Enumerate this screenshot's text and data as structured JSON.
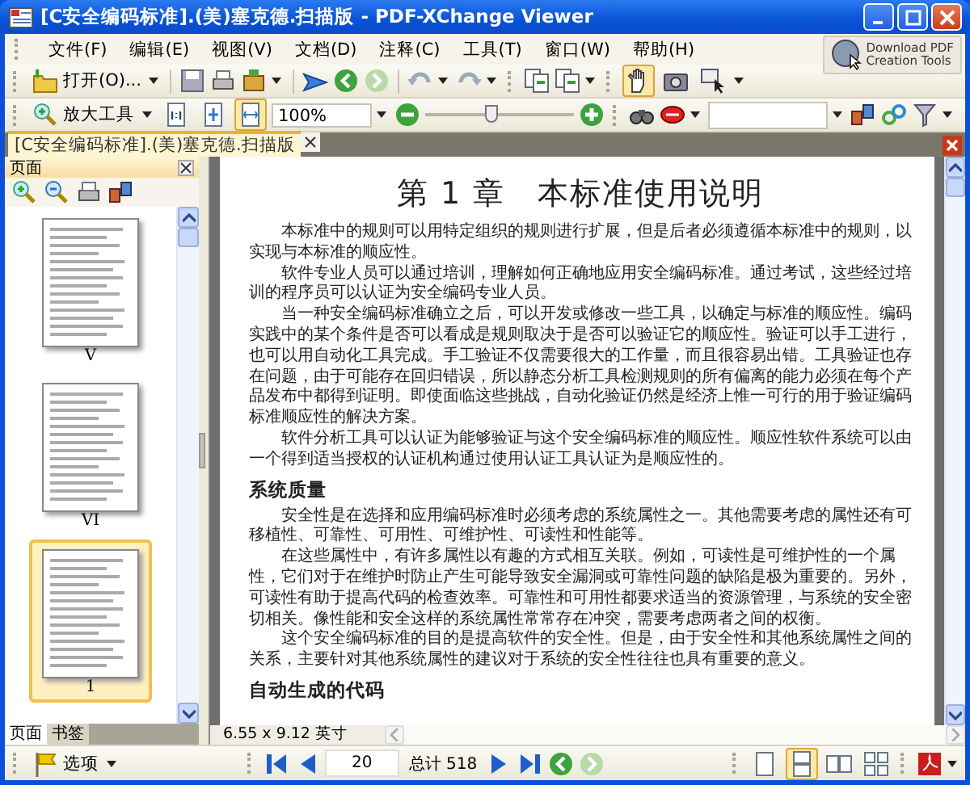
{
  "window": {
    "title": "[C安全编码标准].(美)塞克德.扫描版 - PDF-XChange Viewer"
  },
  "menu": [
    {
      "label": "文件(F)"
    },
    {
      "label": "编辑(E)"
    },
    {
      "label": "视图(V)"
    },
    {
      "label": "文档(D)"
    },
    {
      "label": "注释(C)"
    },
    {
      "label": "工具(T)"
    },
    {
      "label": "窗口(W)"
    },
    {
      "label": "帮助(H)"
    }
  ],
  "download_button": {
    "lines": [
      "Download PDF",
      "Creation Tools"
    ]
  },
  "main_toolbar": {
    "open_label": "打开(O)...",
    "tools": [
      {
        "selected": true
      },
      {
        "selected": false
      },
      {
        "selected": false
      }
    ]
  },
  "zoom_toolbar": {
    "tool_label": "放大工具",
    "fit_modes": [
      {
        "selected": false
      },
      {
        "selected": false
      },
      {
        "selected": true
      }
    ],
    "zoom_value": "100%",
    "zoom_slider": {
      "level": 0.45
    }
  },
  "document_tab": {
    "label": "[C安全编码标准].(美)塞克德.扫描版",
    "selected": true
  },
  "pages_panel": {
    "title": "页面",
    "thumbnails": [
      {
        "label": "V",
        "selected": false
      },
      {
        "label": "VI",
        "selected": false
      },
      {
        "label": "1",
        "selected": true
      }
    ],
    "tabs": [
      {
        "label": "页面",
        "selected": true
      },
      {
        "label": "书签",
        "selected": false
      }
    ]
  },
  "document": {
    "heading": "第 1 章　本标准使用说明",
    "blocks": [
      {
        "kind": "paragraph",
        "text": "本标准中的规则可以用特定组织的规则进行扩展，但是后者必须遵循本标准中的规则，以实现与本标准的顺应性。"
      },
      {
        "kind": "paragraph",
        "text": "软件专业人员可以通过培训，理解如何正确地应用安全编码标准。通过考试，这些经过培训的程序员可以认证为安全编码专业人员。"
      },
      {
        "kind": "paragraph",
        "text": "当一种安全编码标准确立之后，可以开发或修改一些工具，以确定与标准的顺应性。编码实践中的某个条件是否可以看成是规则取决于是否可以验证它的顺应性。验证可以手工进行，也可以用自动化工具完成。手工验证不仅需要很大的工作量，而且很容易出错。工具验证也存在问题，由于可能存在回归错误，所以静态分析工具检测规则的所有偏离的能力必须在每个产品发布中都得到证明。即使面临这些挑战，自动化验证仍然是经济上惟一可行的用于验证编码标准顺应性的解决方案。"
      },
      {
        "kind": "paragraph",
        "text": "软件分析工具可以认证为能够验证与这个安全编码标准的顺应性。顺应性软件系统可以由一个得到适当授权的认证机构通过使用认证工具认证为是顺应性的。"
      },
      {
        "kind": "section",
        "text": "系统质量"
      },
      {
        "kind": "paragraph",
        "text": "安全性是在选择和应用编码标准时必须考虑的系统属性之一。其他需要考虑的属性还有可移植性、可靠性、可用性、可维护性、可读性和性能等。"
      },
      {
        "kind": "paragraph",
        "text": "在这些属性中，有许多属性以有趣的方式相互关联。例如，可读性是可维护性的一个属性，它们对于在维护时防止产生可能导致安全漏洞或可靠性问题的缺陷是极为重要的。另外，可读性有助于提高代码的检查效率。可靠性和可用性都要求适当的资源管理，与系统的安全密切相关。像性能和安全这样的系统属性常常存在冲突，需要考虑两者之间的权衡。"
      },
      {
        "kind": "paragraph",
        "text": "这个安全编码标准的目的是提高软件的安全性。但是，由于安全性和其他系统属性之间的关系，主要针对其他系统属性的建议对于系统的安全性往往也具有重要的意义。"
      },
      {
        "kind": "section",
        "text": "自动生成的代码"
      }
    ]
  },
  "page_size": "6.55 x 9.12 英寸",
  "bottom_toolbar": {
    "options_label": "选项",
    "page_number": "20",
    "page_total": "总计 518",
    "layouts": [
      {
        "selected": false
      },
      {
        "selected": true
      },
      {
        "selected": false
      },
      {
        "selected": false
      }
    ]
  }
}
